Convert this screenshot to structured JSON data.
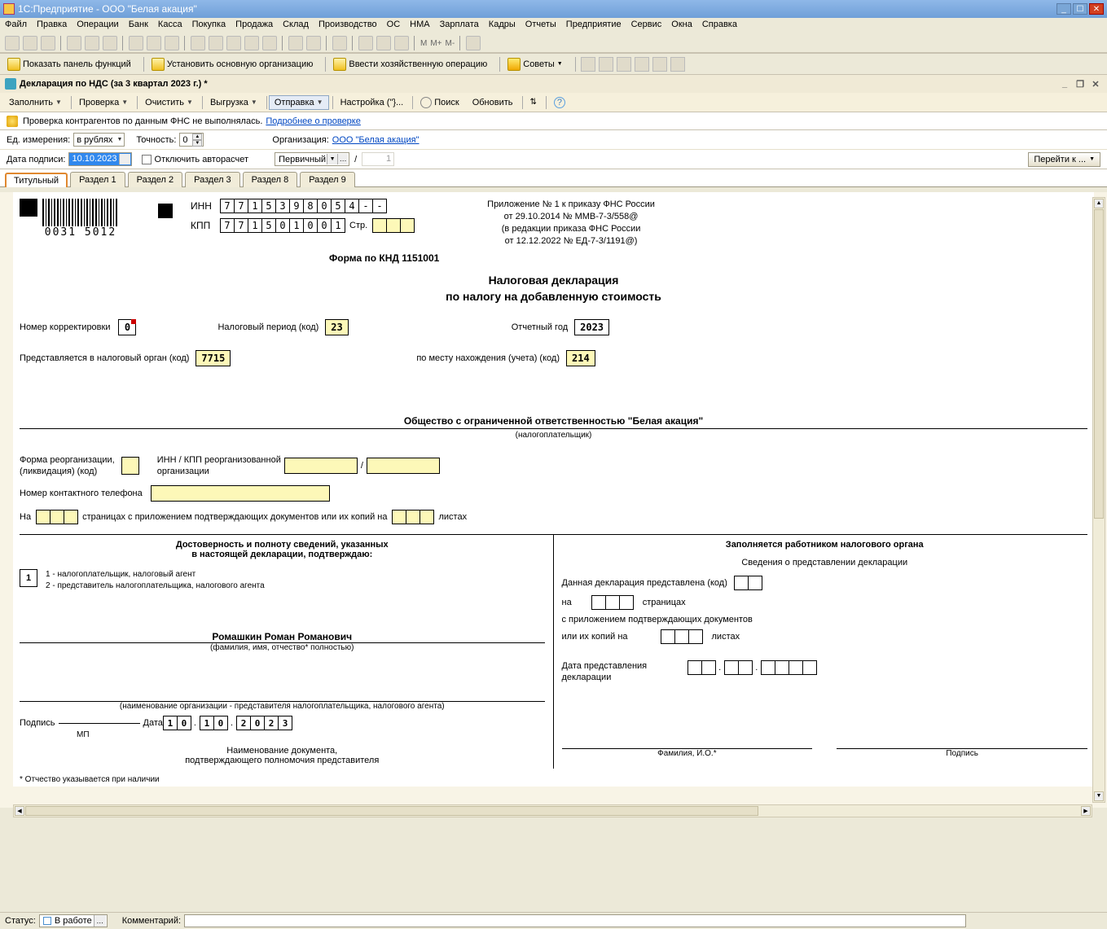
{
  "window": {
    "title": "1С:Предприятие - ООО \"Белая акация\""
  },
  "menu": {
    "items": [
      "Файл",
      "Правка",
      "Операции",
      "Банк",
      "Касса",
      "Покупка",
      "Продажа",
      "Склад",
      "Производство",
      "ОС",
      "НМА",
      "Зарплата",
      "Кадры",
      "Отчеты",
      "Предприятие",
      "Сервис",
      "Окна",
      "Справка"
    ]
  },
  "toolbar2": {
    "btn1": "Показать панель функций",
    "btn2": "Установить основную организацию",
    "btn3": "Ввести хозяйственную операцию",
    "btn4": "Советы"
  },
  "doc_title": "Декларация по НДС (за 3 квартал 2023 г.) *",
  "cmdbar": {
    "fill": "Заполнить",
    "check": "Проверка",
    "clear": "Очистить",
    "export": "Выгрузка",
    "send": "Отправка",
    "setup": "Настройка (\"}...",
    "search": "Поиск",
    "refresh": "Обновить"
  },
  "alert": {
    "text": "Проверка контрагентов по данным ФНС не выполнялась.",
    "link": "Подробнее о проверке"
  },
  "params": {
    "unit_label": "Ед. измерения:",
    "unit": "в рублях",
    "precision_label": "Точность:",
    "precision": "0",
    "org_label": "Организация:",
    "org_value": "ООО \"Белая акация\"",
    "date_label": "Дата подписи:",
    "date": "10.10.2023",
    "autocalc": "Отключить авторасчет",
    "primary": "Первичный",
    "slash": "/",
    "corr": "1",
    "goto": "Перейти к ..."
  },
  "tabs": [
    "Титульный",
    "Раздел 1",
    "Раздел 2",
    "Раздел 3",
    "Раздел 8",
    "Раздел 9"
  ],
  "form": {
    "barcode_num": "0031 5012",
    "inn_label": "ИНН",
    "inn": [
      "7",
      "7",
      "1",
      "5",
      "3",
      "9",
      "8",
      "0",
      "5",
      "4",
      "-",
      "-"
    ],
    "kpp_label": "КПП",
    "kpp": [
      "7",
      "7",
      "1",
      "5",
      "0",
      "1",
      "0",
      "0",
      "1"
    ],
    "page_label": "Стр.",
    "page_cells": [
      "",
      "",
      ""
    ],
    "order_l1": "Приложение № 1 к приказу ФНС России",
    "order_l2": "от 29.10.2014 № ММВ-7-3/558@",
    "order_l3": "(в редакции приказа ФНС России",
    "order_l4": "от 12.12.2022 № ЕД-7-3/1191@)",
    "knd": "Форма по КНД 1151001",
    "title_l1": "Налоговая декларация",
    "title_l2": "по налогу на добавленную стоимость",
    "corr_label": "Номер корректировки",
    "corr": "0",
    "period_label": "Налоговый период (код)",
    "period": "23",
    "year_label": "Отчетный год",
    "year": "2023",
    "tax_auth_label": "Представляется в налоговый орган (код)",
    "tax_auth": "7715",
    "place_label": "по месту нахождения (учета) (код)",
    "place": "214",
    "org_full": "Общество с ограниченной ответственностью \"Белая акация\"",
    "org_sub": "(налогоплательщик)",
    "reorg_label_l1": "Форма реорганизации,",
    "reorg_label_l2": "(ликвидация) (код)",
    "reorg_inn_l1": "ИНН / КПП реорганизованной",
    "reorg_inn_l2": "организации",
    "slash": "/",
    "contact_label": "Номер контактного телефона",
    "on": "На",
    "pages_txt": "страницах с приложением подтверждающих документов или их копий на",
    "sheets": "листах",
    "left_hdr_l1": "Достоверность и полноту сведений, указанных",
    "left_hdr_l2": "в настоящей декларации, подтверждаю:",
    "opt": "1",
    "opt1": "1 - налогоплательщик, налоговый агент",
    "opt2": "2 - представитель налогоплательщика, налогового агента",
    "fio": "Ромашкин Роман Романович",
    "fio_sub": "(фамилия, имя, отчество* полностью)",
    "rep_sub": "(наименование организации - представителя налогоплательщика, налогового агента)",
    "sign_lbl": "Подпись",
    "date_lbl": "Дата",
    "sign_date": [
      "1",
      "0",
      "1",
      "0",
      "2",
      "0",
      "2",
      "3"
    ],
    "mp": "МП",
    "doc_l1": "Наименование документа,",
    "doc_l2": "подтверждающего полномочия представителя",
    "right_hdr": "Заполняется работником налогового органа",
    "right_sub": "Сведения о представлении декларации",
    "right_r1": "Данная декларация представлена   (код)",
    "right_on": "на",
    "right_pages": "страницах",
    "right_att": "с приложением подтверждающих документов",
    "right_att2": "или их копий на",
    "right_sheets": "листах",
    "right_date_l1": "Дата представления",
    "right_date_l2": "декларации",
    "right_fio": "Фамилия, И.О.*",
    "right_sign": "Подпись",
    "footnote": "* Отчество указывается при наличии"
  },
  "statusbar": {
    "status_label": "Статус:",
    "status": "В работе",
    "comment_label": "Комментарий:"
  }
}
